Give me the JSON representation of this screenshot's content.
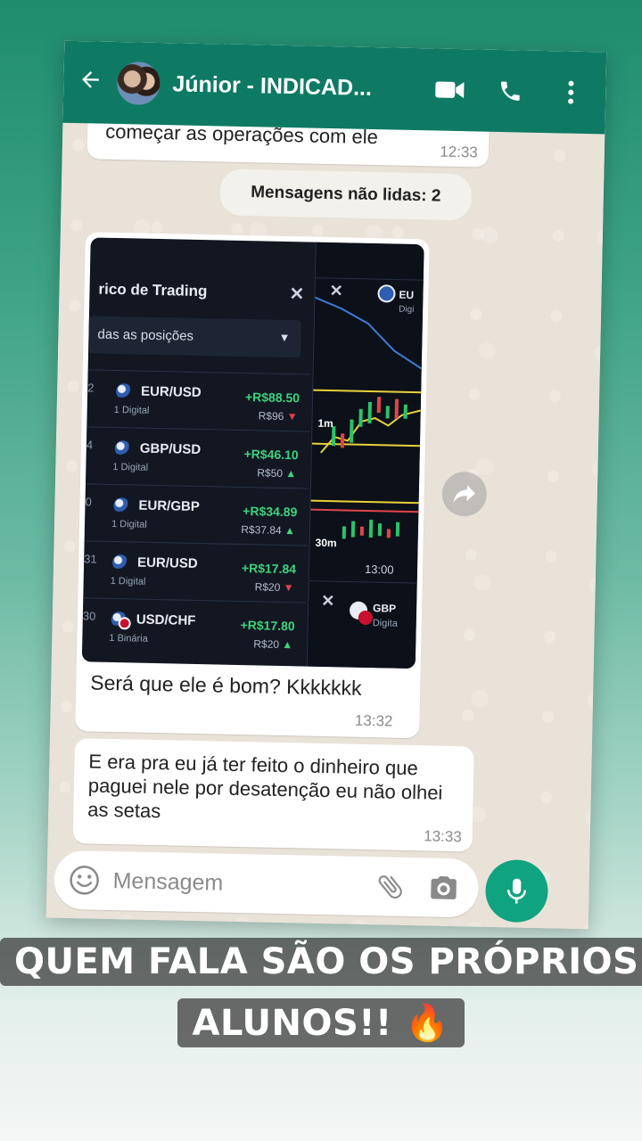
{
  "header": {
    "contact_name": "Júnior - INDICAD..."
  },
  "messages": {
    "previous_text": "começar as operações com ele",
    "previous_time": "12:33",
    "unread_label": "Mensagens não lidas: 2",
    "image_caption": "Será que ele é bom? Kkkkkkk",
    "image_time": "13:32",
    "second_text": "E era pra eu já ter feito o dinheiro que paguei nele por desatenção eu não olhei as setas",
    "second_time": "13:33"
  },
  "composer": {
    "placeholder": "Mensagem"
  },
  "trading_screenshot": {
    "panel_title": "rico de Trading",
    "filter_label": "das as posições",
    "positions": [
      {
        "idx": "2",
        "pair": "EUR/USD",
        "type": "1 Digital",
        "profit": "+R$88.50",
        "stake": "R$96",
        "direction": "down"
      },
      {
        "idx": "4",
        "pair": "GBP/USD",
        "type": "1 Digital",
        "profit": "+R$46.10",
        "stake": "R$50",
        "direction": "up"
      },
      {
        "idx": "0",
        "pair": "EUR/GBP",
        "type": "1 Digital",
        "profit": "+R$34.89",
        "stake": "R$37.84",
        "direction": "up"
      },
      {
        "idx": "31",
        "pair": "EUR/USD",
        "type": "1 Digital",
        "profit": "+R$17.84",
        "stake": "R$20",
        "direction": "down"
      },
      {
        "idx": "30",
        "pair": "USD/CHF",
        "type": "1 Binária",
        "profit": "+R$17.80",
        "stake": "R$20",
        "direction": "up"
      }
    ],
    "chart_label_1m": "1m",
    "chart_label_30m": "30m",
    "chart_time": "13:00",
    "top_asset": "EU",
    "top_asset_type": "Digi",
    "bottom_asset": "GBP",
    "bottom_asset_type": "Digita"
  },
  "story": {
    "caption_line1": "QUEM FALA SÃO OS PRÓPRIOS",
    "caption_line2": "ALUNOS!! 🔥"
  },
  "colors": {
    "header_green": "#0e7a64",
    "mic_green": "#10a37f",
    "profit_green": "#3fd27c",
    "loss_red": "#e0454c"
  }
}
